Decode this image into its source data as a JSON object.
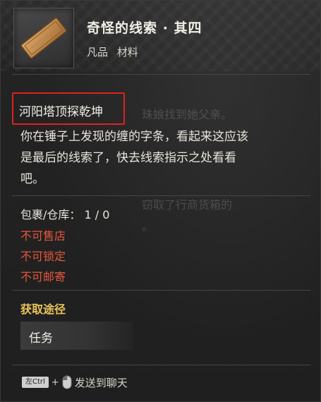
{
  "item": {
    "title": "奇怪的线索 · 其四",
    "rarity": "凡品",
    "category": "材料",
    "icon": "scroll-slip-icon"
  },
  "highlight": {
    "location_name": "河阳塔顶探乾坤",
    "box_color": "#e02020"
  },
  "description": {
    "lines": [
      "你在锤子上发现的缠的字条，看起来这应该",
      "是最后的线索了，快去线索指示之处看看",
      "吧。"
    ]
  },
  "background_ghost_text": {
    "line1": "珠娘找到她父亲。",
    "line2": "窃取了行商货箱的",
    "line3": "。"
  },
  "stock": {
    "label": "包裹/仓库：",
    "bag": "1",
    "separator": "/",
    "warehouse": "0"
  },
  "restrictions": [
    "不可售店",
    "不可锁定",
    "不可邮寄"
  ],
  "restriction_color": "#e8573c",
  "source_section": {
    "title": "获取途径",
    "title_color": "#e9c45a",
    "entries": [
      "任务"
    ]
  },
  "footer": {
    "key_label": "左Ctrl",
    "plus": "+",
    "mouse_icon": "mouse-left-click-icon",
    "action_label": "发送到聊天"
  }
}
